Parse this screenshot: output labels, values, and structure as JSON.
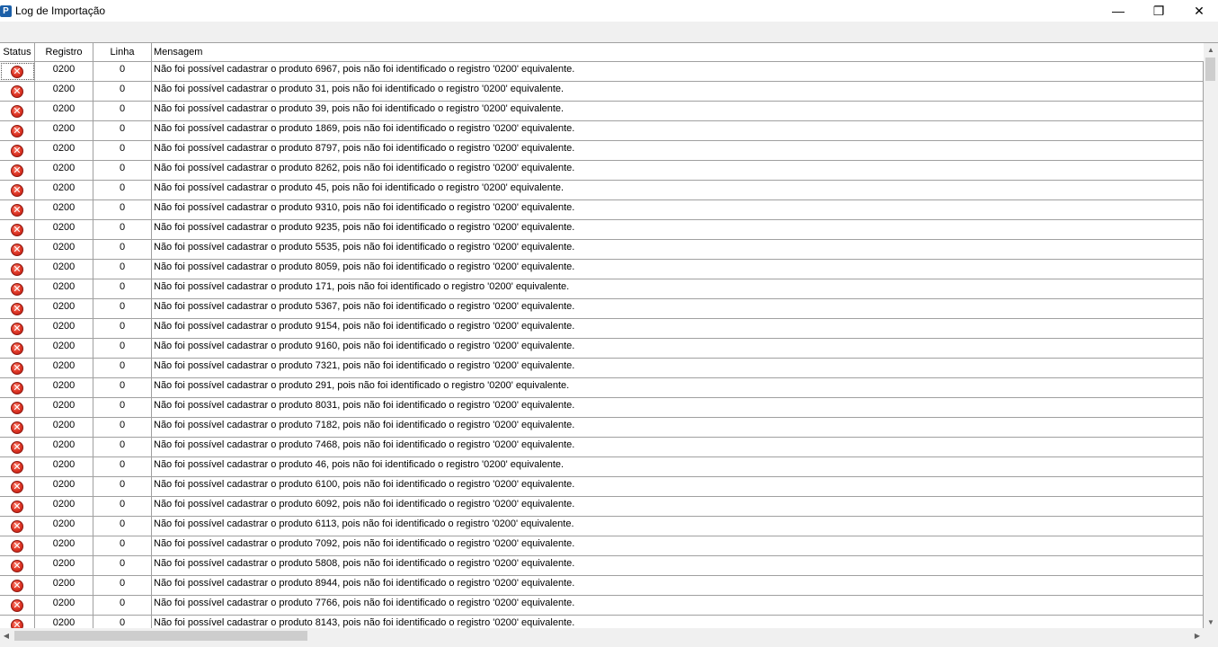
{
  "window": {
    "title": "Log de Importação",
    "app_icon_letter": "P",
    "minimize_glyph": "—",
    "maximize_glyph": "❐",
    "close_glyph": "✕"
  },
  "grid": {
    "columns": {
      "status": "Status",
      "registro": "Registro",
      "linha": "Linha",
      "mensagem": "Mensagem"
    },
    "status_icon": "error-icon",
    "status_glyph": "✕",
    "rows": [
      {
        "registro": "0200",
        "linha": "0",
        "mensagem": "Não foi possível cadastrar o produto 6967, pois não foi identificado o registro '0200' equivalente."
      },
      {
        "registro": "0200",
        "linha": "0",
        "mensagem": "Não foi possível cadastrar o produto 31, pois não foi identificado o registro '0200' equivalente."
      },
      {
        "registro": "0200",
        "linha": "0",
        "mensagem": "Não foi possível cadastrar o produto 39, pois não foi identificado o registro '0200' equivalente."
      },
      {
        "registro": "0200",
        "linha": "0",
        "mensagem": "Não foi possível cadastrar o produto 1869, pois não foi identificado o registro '0200' equivalente."
      },
      {
        "registro": "0200",
        "linha": "0",
        "mensagem": "Não foi possível cadastrar o produto 8797, pois não foi identificado o registro '0200' equivalente."
      },
      {
        "registro": "0200",
        "linha": "0",
        "mensagem": "Não foi possível cadastrar o produto 8262, pois não foi identificado o registro '0200' equivalente."
      },
      {
        "registro": "0200",
        "linha": "0",
        "mensagem": "Não foi possível cadastrar o produto 45, pois não foi identificado o registro '0200' equivalente."
      },
      {
        "registro": "0200",
        "linha": "0",
        "mensagem": "Não foi possível cadastrar o produto 9310, pois não foi identificado o registro '0200' equivalente."
      },
      {
        "registro": "0200",
        "linha": "0",
        "mensagem": "Não foi possível cadastrar o produto 9235, pois não foi identificado o registro '0200' equivalente."
      },
      {
        "registro": "0200",
        "linha": "0",
        "mensagem": "Não foi possível cadastrar o produto 5535, pois não foi identificado o registro '0200' equivalente."
      },
      {
        "registro": "0200",
        "linha": "0",
        "mensagem": "Não foi possível cadastrar o produto 8059, pois não foi identificado o registro '0200' equivalente."
      },
      {
        "registro": "0200",
        "linha": "0",
        "mensagem": "Não foi possível cadastrar o produto 171, pois não foi identificado o registro '0200' equivalente."
      },
      {
        "registro": "0200",
        "linha": "0",
        "mensagem": "Não foi possível cadastrar o produto 5367, pois não foi identificado o registro '0200' equivalente."
      },
      {
        "registro": "0200",
        "linha": "0",
        "mensagem": "Não foi possível cadastrar o produto 9154, pois não foi identificado o registro '0200' equivalente."
      },
      {
        "registro": "0200",
        "linha": "0",
        "mensagem": "Não foi possível cadastrar o produto 9160, pois não foi identificado o registro '0200' equivalente."
      },
      {
        "registro": "0200",
        "linha": "0",
        "mensagem": "Não foi possível cadastrar o produto 7321, pois não foi identificado o registro '0200' equivalente."
      },
      {
        "registro": "0200",
        "linha": "0",
        "mensagem": "Não foi possível cadastrar o produto 291, pois não foi identificado o registro '0200' equivalente."
      },
      {
        "registro": "0200",
        "linha": "0",
        "mensagem": "Não foi possível cadastrar o produto 8031, pois não foi identificado o registro '0200' equivalente."
      },
      {
        "registro": "0200",
        "linha": "0",
        "mensagem": "Não foi possível cadastrar o produto 7182, pois não foi identificado o registro '0200' equivalente."
      },
      {
        "registro": "0200",
        "linha": "0",
        "mensagem": "Não foi possível cadastrar o produto 7468, pois não foi identificado o registro '0200' equivalente."
      },
      {
        "registro": "0200",
        "linha": "0",
        "mensagem": "Não foi possível cadastrar o produto 46, pois não foi identificado o registro '0200' equivalente."
      },
      {
        "registro": "0200",
        "linha": "0",
        "mensagem": "Não foi possível cadastrar o produto 6100, pois não foi identificado o registro '0200' equivalente."
      },
      {
        "registro": "0200",
        "linha": "0",
        "mensagem": "Não foi possível cadastrar o produto 6092, pois não foi identificado o registro '0200' equivalente."
      },
      {
        "registro": "0200",
        "linha": "0",
        "mensagem": "Não foi possível cadastrar o produto 6113, pois não foi identificado o registro '0200' equivalente."
      },
      {
        "registro": "0200",
        "linha": "0",
        "mensagem": "Não foi possível cadastrar o produto 7092, pois não foi identificado o registro '0200' equivalente."
      },
      {
        "registro": "0200",
        "linha": "0",
        "mensagem": "Não foi possível cadastrar o produto 5808, pois não foi identificado o registro '0200' equivalente."
      },
      {
        "registro": "0200",
        "linha": "0",
        "mensagem": "Não foi possível cadastrar o produto 8944, pois não foi identificado o registro '0200' equivalente."
      },
      {
        "registro": "0200",
        "linha": "0",
        "mensagem": "Não foi possível cadastrar o produto 7766, pois não foi identificado o registro '0200' equivalente."
      },
      {
        "registro": "0200",
        "linha": "0",
        "mensagem": "Não foi possível cadastrar o produto 8143, pois não foi identificado o registro '0200' equivalente."
      }
    ]
  },
  "scrollbars": {
    "up_glyph": "▲",
    "down_glyph": "▼",
    "left_glyph": "◀",
    "right_glyph": "▶"
  }
}
